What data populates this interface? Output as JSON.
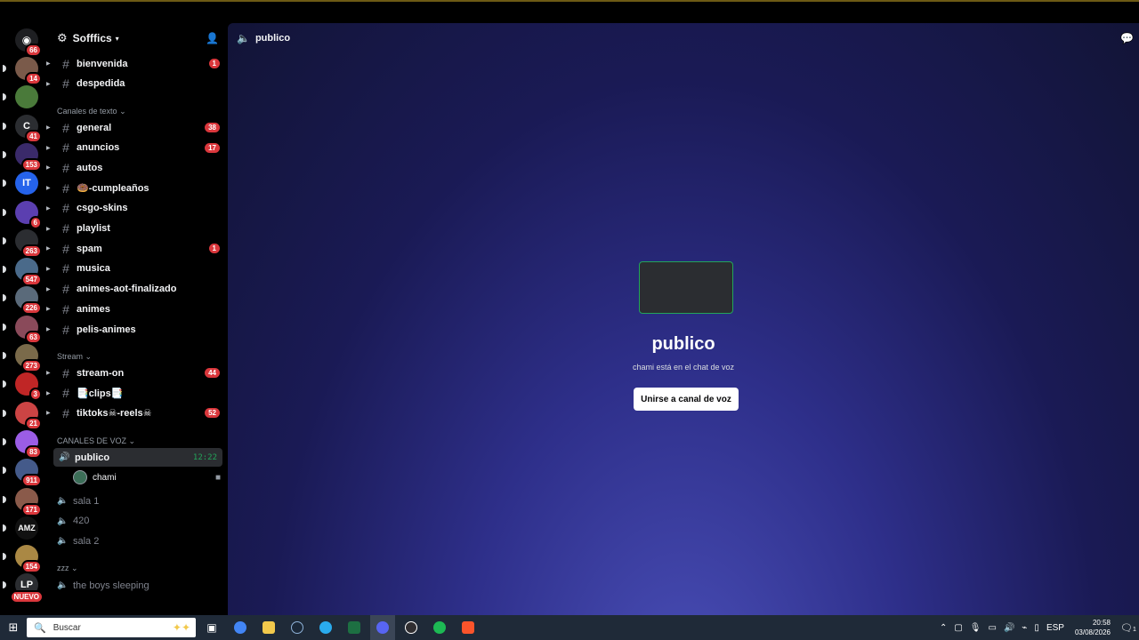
{
  "guild": {
    "name": "Sofffics"
  },
  "rail": {
    "home_badge": "66",
    "servers": [
      {
        "badge": "14"
      },
      {
        "badge": ""
      },
      {
        "initial": "C",
        "badge": "41"
      },
      {
        "badge": "153"
      },
      {
        "initial": "IT",
        "badge": ""
      },
      {
        "badge": "6"
      },
      {
        "badge": "263"
      },
      {
        "badge": "547"
      },
      {
        "badge": "226"
      },
      {
        "badge": "63"
      },
      {
        "badge": "273"
      },
      {
        "badge": "3"
      },
      {
        "badge": "21"
      },
      {
        "badge": "83"
      },
      {
        "badge": "911"
      },
      {
        "badge": "171"
      },
      {
        "initial": "AMZ",
        "badge": ""
      },
      {
        "badge": "154"
      },
      {
        "initial": "LP",
        "badge": "NUEVO"
      }
    ]
  },
  "channels": {
    "top": [
      {
        "name": "bienvenida",
        "count": "1"
      },
      {
        "name": "despedida",
        "count": ""
      }
    ],
    "text_category": "Canales de texto",
    "text": [
      {
        "name": "general",
        "count": "38"
      },
      {
        "name": "anuncios",
        "count": "17"
      },
      {
        "name": "autos",
        "count": ""
      },
      {
        "name": "🍩-cumpleaños",
        "count": ""
      },
      {
        "name": "csgo-skins",
        "count": ""
      },
      {
        "name": "playlist",
        "count": ""
      },
      {
        "name": "spam",
        "count": "1"
      },
      {
        "name": "musica",
        "count": ""
      },
      {
        "name": "animes-aot-finalizado",
        "count": ""
      },
      {
        "name": "animes",
        "count": ""
      },
      {
        "name": "pelis-animes",
        "count": ""
      }
    ],
    "stream_category": "Stream",
    "stream": [
      {
        "name": "stream-on",
        "count": "44"
      },
      {
        "name": "📑clips📑",
        "count": ""
      },
      {
        "name": "tiktoks☠-reels☠",
        "count": "52"
      }
    ],
    "voice_category": "CANALES DE VOZ",
    "voice_active": {
      "name": "publico",
      "time": "12:22",
      "user": "chami"
    },
    "voice": [
      {
        "name": "sala 1"
      },
      {
        "name": "420"
      },
      {
        "name": "sala 2"
      }
    ],
    "zzz_category": "zzz",
    "zzz": [
      {
        "name": "the boys sleeping"
      }
    ]
  },
  "main": {
    "header_title": "publico",
    "voice_title": "publico",
    "voice_subtitle": "chami está en el chat de voz",
    "join_label": "Unirse a canal de voz"
  },
  "taskbar": {
    "search_placeholder": "Buscar",
    "lang": "ESP",
    "time": "20:58",
    "date": "03/08/2026",
    "notif_count": "1"
  },
  "colors": {
    "accent_green": "#23a55a",
    "badge_red": "#da373c",
    "main_bg_center": "#4a4fb8",
    "main_bg_edge": "#121436"
  }
}
